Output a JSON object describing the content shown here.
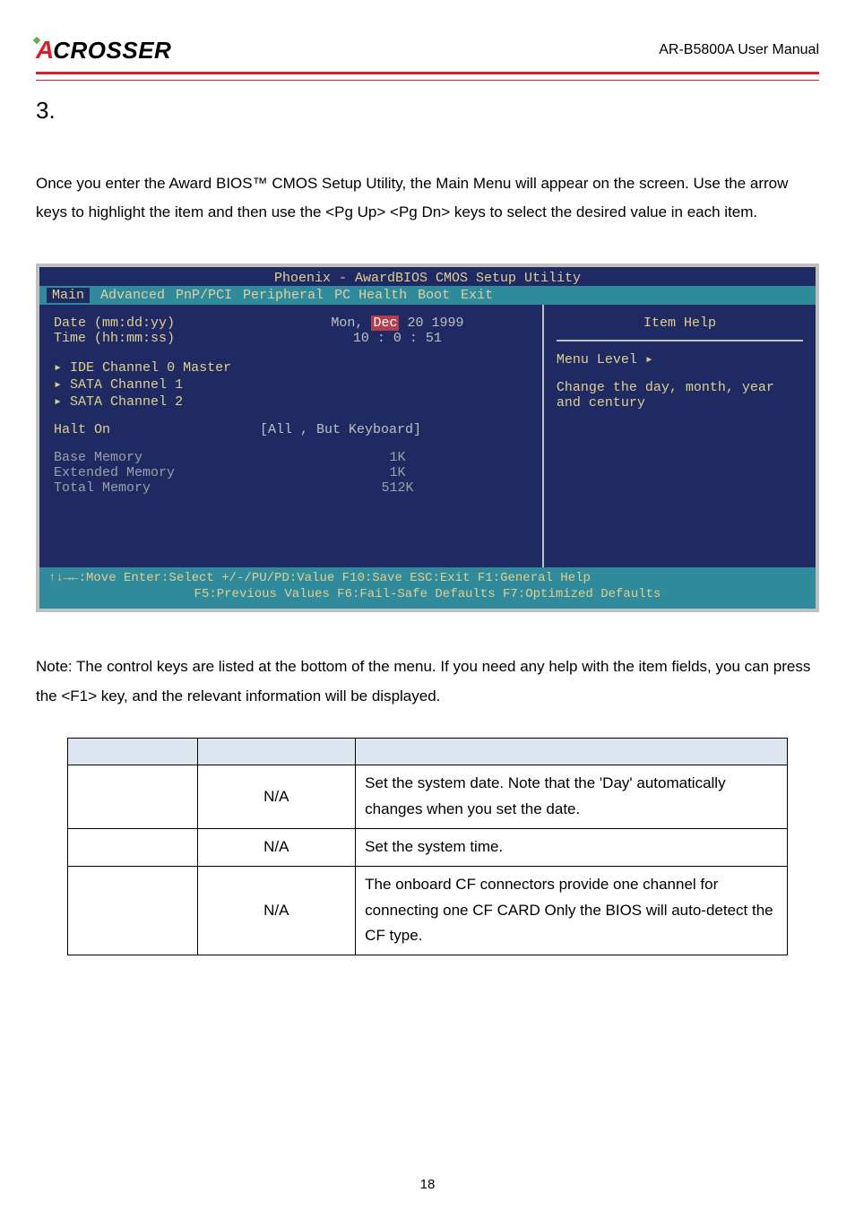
{
  "header": {
    "logo_a": "A",
    "logo_rest": "CROSSER",
    "doc_title": "AR-B5800A User Manual"
  },
  "section_number": "3.",
  "intro_text": "Once you enter the Award BIOS™ CMOS Setup Utility, the Main Menu will appear on the screen. Use the arrow keys to highlight the item and then use the <Pg Up> <Pg Dn> keys to select the desired value in each item.",
  "bios": {
    "title": "Phoenix - AwardBIOS CMOS Setup Utility",
    "menus": [
      "Main",
      "Advanced",
      "PnP/PCI",
      "Peripheral",
      "PC Health",
      "Boot",
      "Exit"
    ],
    "active_menu": "Main",
    "rows": {
      "date_label": "Date (mm:dd:yy)",
      "date_prefix": "Mon, ",
      "date_hl": "Dec",
      "date_suffix": " 20 1999",
      "time_label": "Time (hh:mm:ss)",
      "time_value": "10 :  0 : 51",
      "ide0": "IDE Channel 0 Master",
      "sata1": "SATA Channel 1",
      "sata2": "SATA Channel 2",
      "halt_label": "Halt On",
      "halt_value": "[All , But Keyboard]",
      "base_label": "Base Memory",
      "base_value": "1K",
      "ext_label": "Extended Memory",
      "ext_value": "1K",
      "total_label": "Total Memory",
      "total_value": "512K"
    },
    "help": {
      "title": "Item Help",
      "level": "Menu Level   ▸",
      "body": "Change the day, month, year and century"
    },
    "footer1": "↑↓→←:Move  Enter:Select  +/-/PU/PD:Value  F10:Save  ESC:Exit  F1:General Help",
    "footer2": "F5:Previous Values    F6:Fail-Safe Defaults    F7:Optimized Defaults"
  },
  "note_text": "Note: The control keys are listed at the bottom of the menu. If you need any help with the item fields, you can press the <F1> key, and the relevant information will be displayed.",
  "table": {
    "headers": [
      "",
      "",
      ""
    ],
    "rows": [
      {
        "item": "",
        "option": "N/A",
        "desc": "Set the system date. Note that the 'Day' automatically changes when you set the date."
      },
      {
        "item": "",
        "option": "N/A",
        "desc": "Set the system time."
      },
      {
        "item": "",
        "option": "N/A",
        "desc": "The onboard CF connectors provide one channel for connecting one CF CARD Only the BIOS will auto-detect the CF type."
      }
    ]
  },
  "page_number": "18"
}
